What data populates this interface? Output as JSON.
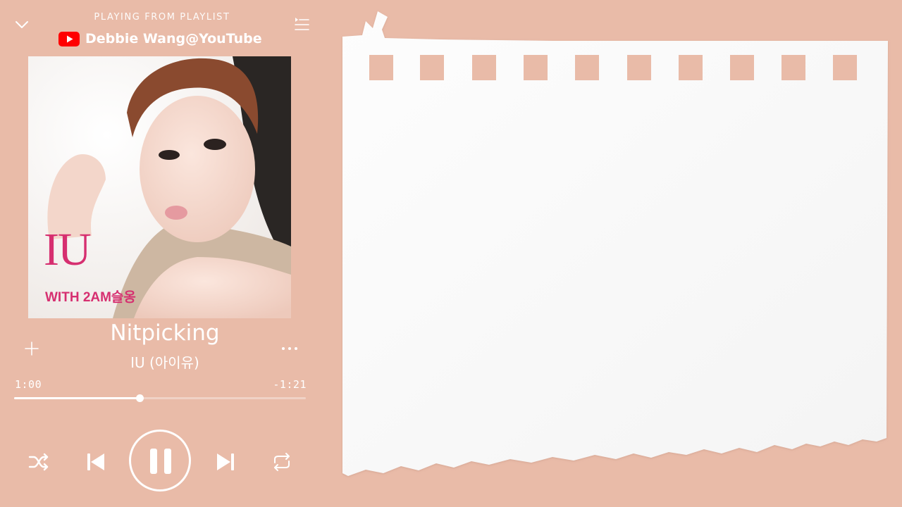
{
  "header": {
    "label": "PLAYING FROM PLAYLIST",
    "channel": "Debbie Wang@YouTube"
  },
  "album": {
    "logo_text": "IU",
    "subtitle": "WITH 2AM슬옹"
  },
  "track": {
    "title": "Nitpicking",
    "artist": "IU (아이유)"
  },
  "playback": {
    "elapsed": "1:00",
    "remaining": "-1:21",
    "progress_fraction": 0.43,
    "state": "playing"
  },
  "icons": {
    "collapse": "chevron-down-icon",
    "queue": "queue-list-icon",
    "channel": "youtube-logo-icon",
    "add": "plus-icon",
    "more": "more-horizontal-icon",
    "shuffle": "shuffle-icon",
    "prev": "skip-previous-icon",
    "pause": "pause-icon",
    "next": "skip-next-icon",
    "repeat": "repeat-icon"
  },
  "colors": {
    "background": "#e9bba8",
    "foreground": "#ffffff",
    "album_accent": "#d62f70",
    "youtube_red": "#ff0000"
  }
}
